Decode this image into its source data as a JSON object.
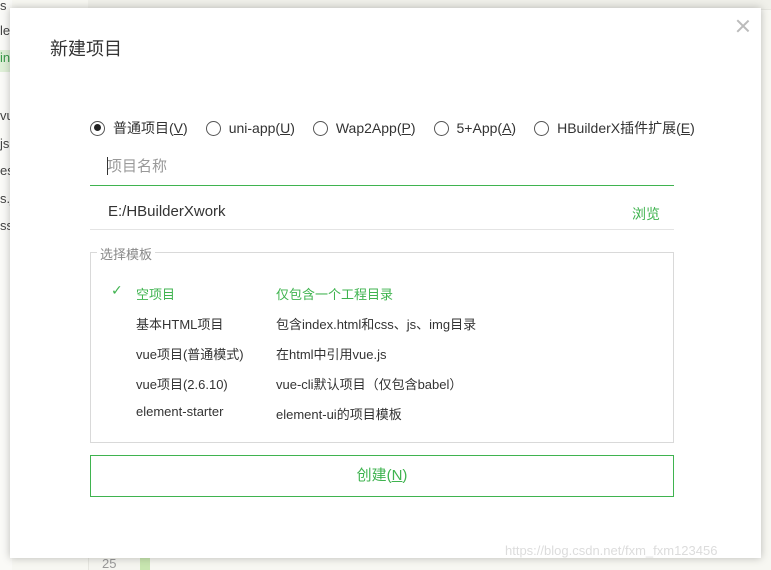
{
  "background": {
    "sidebar_items": [
      "s",
      "le",
      "in",
      "",
      "vu",
      "js",
      "es",
      "s.j",
      "ss"
    ],
    "gutter_line": "25"
  },
  "dialog": {
    "title": "新建项目",
    "project_types": [
      {
        "label": "普通项目",
        "key": "V",
        "checked": true
      },
      {
        "label": "uni-app",
        "key": "U",
        "checked": false
      },
      {
        "label": "Wap2App",
        "key": "P",
        "checked": false
      },
      {
        "label": "5+App",
        "key": "A",
        "checked": false
      },
      {
        "label": "HBuilderX插件扩展",
        "key": "E",
        "checked": false
      }
    ],
    "name_placeholder": "项目名称",
    "path": "E:/HBuilderXwork",
    "browse_label": "浏览",
    "template_legend": "选择模板",
    "templates": [
      {
        "name": "空项目",
        "desc": "仅包含一个工程目录",
        "selected": true
      },
      {
        "name": "基本HTML项目",
        "desc": "包含index.html和css、js、img目录",
        "selected": false
      },
      {
        "name": "vue项目(普通模式)",
        "desc": "在html中引用vue.js",
        "selected": false
      },
      {
        "name": "vue项目(2.6.10)",
        "desc": "vue-cli默认项目（仅包含babel）",
        "selected": false
      },
      {
        "name": "element-starter",
        "desc": "element-ui的项目模板",
        "selected": false
      }
    ],
    "create_label": "创建",
    "create_key": "N"
  },
  "watermark": "https://blog.csdn.net/fxm_fxm123456",
  "colors": {
    "accent": "#3fb34f",
    "check_mark": "✓"
  }
}
